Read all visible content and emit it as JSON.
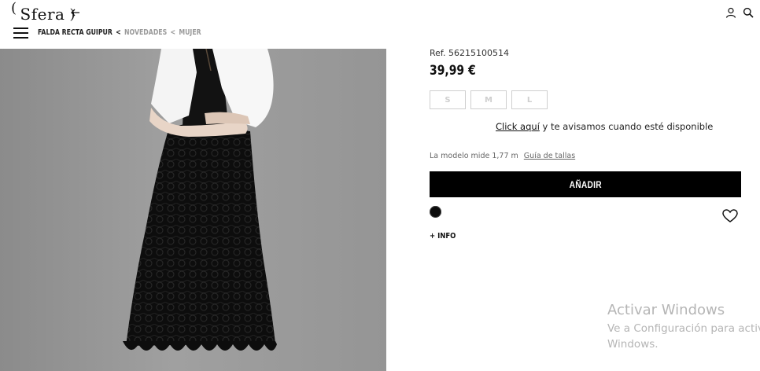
{
  "header": {
    "logo_text": "Sfera",
    "logo_paren_left": "(",
    "logo_paren_right": ")"
  },
  "breadcrumb": {
    "current": "FALDA RECTA GUIPUR",
    "separator": "<",
    "items": [
      "NOVEDADES",
      "MUJER"
    ]
  },
  "product": {
    "ref": "Ref. 56215100514",
    "price": "39,99 €",
    "sizes": [
      "S",
      "M",
      "L"
    ],
    "notify_link": "Click aquí",
    "notify_text": " y te avisamos cuando esté disponible",
    "model_text": "La modelo mide 1,77 m",
    "size_guide": "Guía de tallas",
    "add_button": "AÑADIR",
    "swatch_color": "#0b0b0b",
    "more_info": "+ INFO"
  },
  "icons": {
    "back": "arrow-left-icon",
    "user": "user-icon",
    "search": "search-icon",
    "menu": "hamburger-menu-icon",
    "wishlist": "heart-icon"
  },
  "watermark": {
    "title": "Activar Windows",
    "line2": "Ve a Configuración para activ",
    "line3": "Windows."
  }
}
